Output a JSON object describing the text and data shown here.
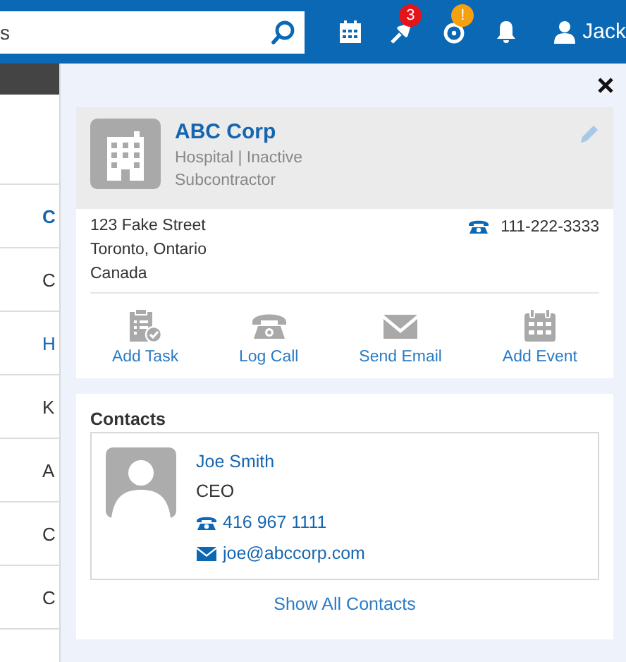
{
  "search": {
    "value": "s"
  },
  "header_icons": [
    {
      "kind": "calendar"
    },
    {
      "kind": "pin",
      "badge": "3",
      "color": "#e5141b"
    },
    {
      "kind": "timer",
      "badge": "!",
      "color": "#f5a00f"
    },
    {
      "kind": "bell"
    }
  ],
  "user": {
    "name": "Jack"
  },
  "list_items": [
    {
      "label": "C",
      "kind": "selected"
    },
    {
      "label": "C",
      "kind": "plain"
    },
    {
      "label": "H",
      "kind": "link"
    },
    {
      "label": "K",
      "kind": "plain"
    },
    {
      "label": "A",
      "kind": "plain"
    },
    {
      "label": "C",
      "kind": "plain"
    },
    {
      "label": "C",
      "kind": "plain"
    }
  ],
  "company": {
    "name": "ABC Corp",
    "details": "Hospital | Inactive",
    "role": "Subcontractor",
    "address": [
      "123 Fake Street",
      "Toronto, Ontario",
      "Canada"
    ],
    "phone": "111-222-3333"
  },
  "actions": [
    {
      "kind": "task",
      "label": "Add Task"
    },
    {
      "kind": "call",
      "label": "Log Call"
    },
    {
      "kind": "email",
      "label": "Send Email"
    },
    {
      "kind": "event",
      "label": "Add Event"
    }
  ],
  "contacts": {
    "title": "Contacts",
    "items": [
      {
        "name": "Joe Smith",
        "title": "CEO",
        "phone": "416 967 1111",
        "email": "joe@abccorp.com"
      }
    ],
    "show_all": "Show All Contacts"
  }
}
